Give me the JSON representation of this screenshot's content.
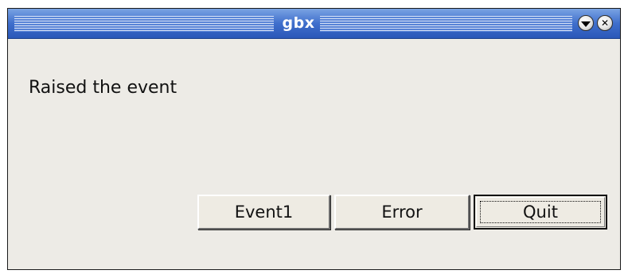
{
  "window": {
    "title": "gbx",
    "titlebar_colors": {
      "top": "#7aa3e3",
      "bottom": "#2a57b8"
    },
    "background": "#edebe6",
    "controls": {
      "minimize_icon": "triangle-down-icon",
      "close_icon": "x-icon",
      "close_glyph": "✕"
    }
  },
  "content": {
    "message": "Raised the event"
  },
  "buttons": {
    "event1_label": "Event1",
    "error_label": "Error",
    "quit_label": "Quit"
  }
}
